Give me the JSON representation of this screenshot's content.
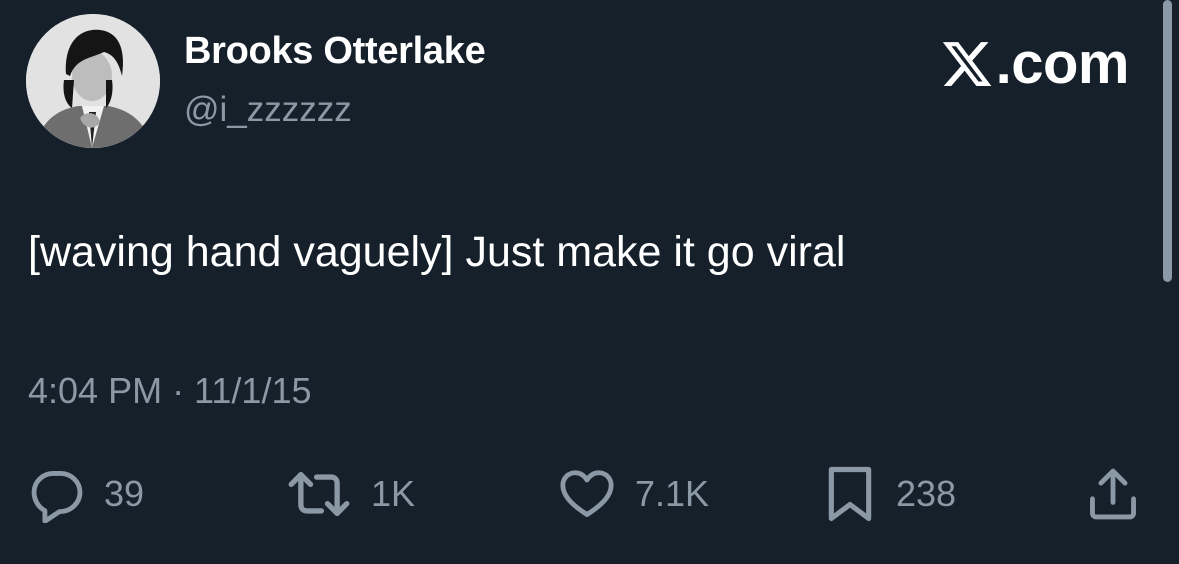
{
  "author": {
    "name": "Brooks Otterlake",
    "handle": "@i_zzzzzz"
  },
  "brand": {
    "label": ".com",
    "icon": "x-logo-icon"
  },
  "tweet": {
    "text": "[waving hand vaguely] Just make it go viral",
    "timestamp": "4:04 PM · 11/1/15"
  },
  "actions": {
    "replies": {
      "icon": "reply-icon",
      "count": "39"
    },
    "retweets": {
      "icon": "retweet-icon",
      "count": "1K"
    },
    "likes": {
      "icon": "heart-icon",
      "count": "7.1K"
    },
    "bookmarks": {
      "icon": "bookmark-icon",
      "count": "238"
    },
    "share": {
      "icon": "share-icon"
    }
  },
  "colors": {
    "background": "#15202b",
    "primary_text": "#ffffff",
    "secondary_text": "#8b98a5"
  }
}
